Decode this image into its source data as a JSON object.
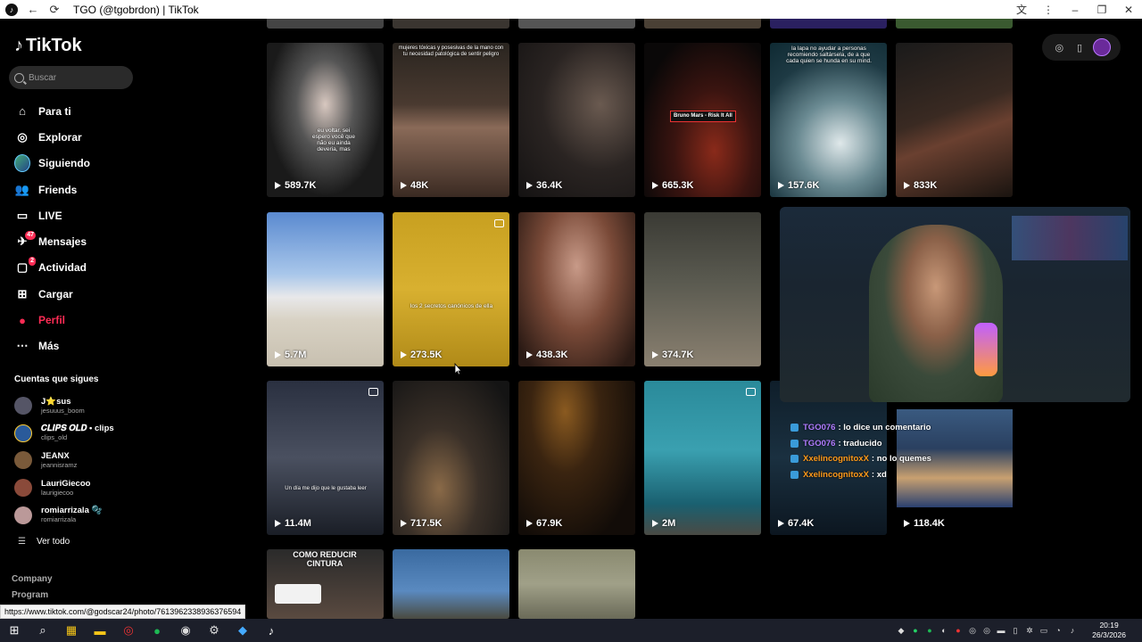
{
  "browser": {
    "title": "TGO (@tgobrdon) | TikTok",
    "status_url": "https://www.tiktok.com/@godscar24/photo/7613962338936376594"
  },
  "sidebar": {
    "logo": "TikTok",
    "search_placeholder": "Buscar",
    "items": [
      {
        "label": "Para ti",
        "icon": "home-icon"
      },
      {
        "label": "Explorar",
        "icon": "compass-icon"
      },
      {
        "label": "Siguiendo",
        "icon": "following-avatar-icon"
      },
      {
        "label": "Friends",
        "icon": "friends-icon"
      },
      {
        "label": "LIVE",
        "icon": "live-icon"
      },
      {
        "label": "Mensajes",
        "icon": "messages-icon",
        "badge": "47"
      },
      {
        "label": "Actividad",
        "icon": "activity-icon",
        "badge": "2"
      },
      {
        "label": "Cargar",
        "icon": "upload-icon"
      },
      {
        "label": "Perfil",
        "icon": "profile-icon"
      },
      {
        "label": "Más",
        "icon": "more-icon"
      }
    ],
    "following_title": "Cuentas que sigues",
    "following": [
      {
        "name": "J⭐sus",
        "user": "jesuuus_boom",
        "color": "#556"
      },
      {
        "name": "𝑪𝑳𝑰𝑷𝑺 𝑶𝑳𝑫 • clips",
        "user": "clips_old",
        "color": "#2a5a9a"
      },
      {
        "name": "JEANX",
        "user": "jeannisramz",
        "color": "#7a5a3a"
      },
      {
        "name": "LauriGiecoo",
        "user": "laurigiecoo",
        "color": "#8a4a3a"
      },
      {
        "name": "romiarrizala 🫧",
        "user": "romiarrizala",
        "color": "#b99"
      }
    ],
    "see_all": "Ver todo",
    "footer": [
      "Company",
      "Program"
    ]
  },
  "videos": [
    {
      "views": "589.7K",
      "caption": "eu voltar. sei espero você que não eu ainda deveria, mas"
    },
    {
      "views": "48K",
      "caption": "mujeres tóxicas y posesivas de la mano con tu necesidad patológica de sentir peligro"
    },
    {
      "views": "36.4K",
      "caption": ""
    },
    {
      "views": "665.3K",
      "caption": "Bruno Mars - Risk It All"
    },
    {
      "views": "157.6K",
      "caption": "la lapa no ayudar a personas recomiendo saltársela, de a que cada quien se hunda en su mind."
    },
    {
      "views": "833K",
      "caption": ""
    },
    {
      "views": "5.7M",
      "caption": ""
    },
    {
      "views": "273.5K",
      "caption": "los 2 secretos canónicos de ella"
    },
    {
      "views": "438.3K",
      "caption": ""
    },
    {
      "views": "374.7K",
      "caption": ""
    },
    {
      "views": "11.4M",
      "caption": "Un día me dijo que le gustaba leer"
    },
    {
      "views": "717.5K",
      "caption": ""
    },
    {
      "views": "67.9K",
      "caption": ""
    },
    {
      "views": "2M",
      "caption": ""
    },
    {
      "views": "67.4K",
      "caption": ""
    },
    {
      "views": "118.4K",
      "caption": ""
    },
    {
      "views": "",
      "caption": "COMO REDUCIR CINTURA"
    },
    {
      "views": "",
      "caption": ""
    },
    {
      "views": "",
      "caption": ""
    }
  ],
  "chat": [
    {
      "user": "TGO076",
      "msg": ": lo dice un comentario",
      "color": "#b07cff"
    },
    {
      "user": "TGO076",
      "msg": ": traducido",
      "color": "#b07cff"
    },
    {
      "user": "XxelincognitoxX",
      "msg": ": no lo quemes",
      "color": "#ff9a1a"
    },
    {
      "user": "XxelincognitoxX",
      "msg": ": xd",
      "color": "#ff9a1a"
    }
  ],
  "clock": {
    "time": "20:19",
    "date": "26/3/2026"
  }
}
